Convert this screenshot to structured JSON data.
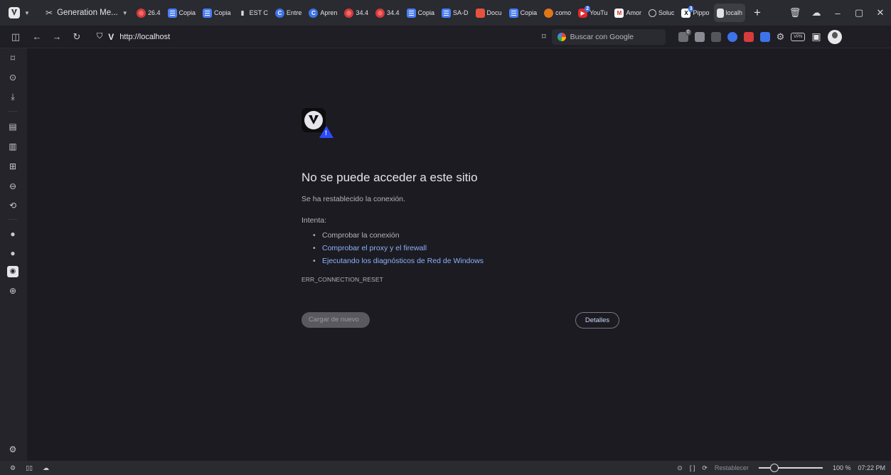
{
  "tabbar": {
    "first_tab": "Generation Me...",
    "tabs": [
      {
        "label": "26.4",
        "icon": "red-circle-icon"
      },
      {
        "label": "Copia",
        "icon": "docs-icon"
      },
      {
        "label": "Copia",
        "icon": "docs-icon"
      },
      {
        "label": "EST C",
        "icon": "lock-icon"
      },
      {
        "label": "Entre",
        "icon": "c-icon"
      },
      {
        "label": "Apren",
        "icon": "c-icon"
      },
      {
        "label": "34.4",
        "icon": "red-circle-icon"
      },
      {
        "label": "34.4",
        "icon": "red-circle-icon"
      },
      {
        "label": "Copia",
        "icon": "docs-icon"
      },
      {
        "label": "SA-D",
        "icon": "docs-icon"
      },
      {
        "label": "Docu",
        "icon": "pdf-icon"
      },
      {
        "label": "Copia",
        "icon": "docs-icon"
      },
      {
        "label": "como",
        "icon": "orange-circle-icon"
      },
      {
        "label": "YouTu",
        "icon": "youtube-icon",
        "badge": "2"
      },
      {
        "label": "Amor",
        "icon": "gmail-icon"
      },
      {
        "label": "Soluc",
        "icon": "globe-icon"
      },
      {
        "label": "Pippo",
        "icon": "x-icon",
        "badge": "3"
      },
      {
        "label": "localh",
        "icon": "page-icon"
      }
    ],
    "new_tab": "+",
    "min": "–",
    "max": "▢",
    "close": "✕"
  },
  "addressbar": {
    "url": "http://localhost",
    "search_placeholder": "Buscar con Google",
    "vpn": "VPN",
    "ext_badge": "0"
  },
  "error": {
    "title": "No se puede acceder a este sitio",
    "subtitle": "Se ha restablecido la conexión.",
    "try_label": "Intenta:",
    "suggestions": [
      "Comprobar la conexión",
      "Comprobar el proxy y el firewall",
      "Ejecutando los diagnósticos de Red de Windows"
    ],
    "code": "ERR_CONNECTION_RESET",
    "reload_button": "Cargar de nuevo",
    "details_button": "Detalles"
  },
  "statusbar": {
    "reset_label": "Restablecer",
    "zoom": "100 %",
    "zoom_level": 0.2,
    "time": "07:22 PM"
  }
}
